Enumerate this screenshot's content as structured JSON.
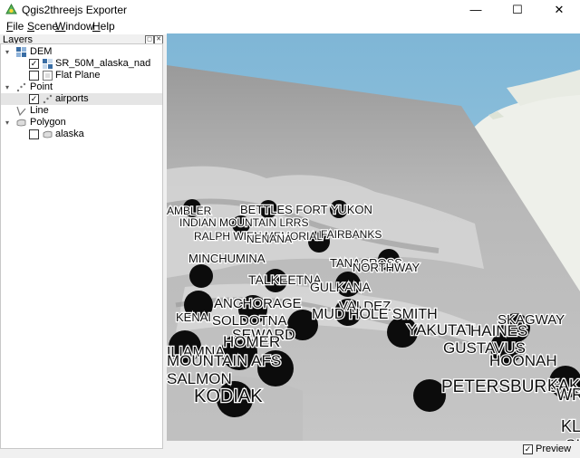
{
  "window": {
    "title": "Qgis2threejs Exporter",
    "controls": {
      "minimize": "—",
      "maximize": "☐",
      "close": "✕"
    }
  },
  "menu": [
    {
      "label": "File",
      "mnemonic": "F",
      "rest": "ile"
    },
    {
      "label": "Scene",
      "mnemonic": "S",
      "rest": "cene"
    },
    {
      "label": "Window",
      "mnemonic": "W",
      "rest": "indow"
    },
    {
      "label": "Help",
      "mnemonic": "H",
      "rest": "elp"
    }
  ],
  "layers_panel": {
    "title": "Layers",
    "groups": [
      {
        "label": "DEM",
        "expanded": true,
        "items": [
          {
            "label": "SR_50M_alaska_nad",
            "checked": true
          },
          {
            "label": "Flat Plane",
            "checked": false
          }
        ]
      },
      {
        "label": "Point",
        "expanded": true,
        "items": [
          {
            "label": "airports",
            "checked": true,
            "selected": true
          }
        ]
      },
      {
        "label": "Line",
        "expanded": false,
        "items": []
      },
      {
        "label": "Polygon",
        "expanded": true,
        "items": [
          {
            "label": "alaska",
            "checked": false
          }
        ]
      }
    ]
  },
  "map_labels": [
    {
      "text": "AMBLER",
      "size": 12
    },
    {
      "text": "BETTLES FORT YUKON",
      "size": 13
    },
    {
      "text": "INDIAN MOUNTAIN LRRS",
      "size": 12
    },
    {
      "text": "RALPH WIEN MEMORIAL",
      "size": 12
    },
    {
      "text": "NENANA",
      "size": 12
    },
    {
      "text": "FAIRBANKS",
      "size": 12
    },
    {
      "text": "MINCHUMINA",
      "size": 13
    },
    {
      "text": "TANACROSS",
      "size": 13
    },
    {
      "text": "NORTHWAY",
      "size": 13
    },
    {
      "text": "TALKEETNA",
      "size": 14
    },
    {
      "text": "GULKANA",
      "size": 14
    },
    {
      "text": "ANCHORAGE",
      "size": 15
    },
    {
      "text": "VALDEZ",
      "size": 15
    },
    {
      "text": "KENAI",
      "size": 13
    },
    {
      "text": "SOLDOTNA",
      "size": 15
    },
    {
      "text": "SEWARD",
      "size": 16
    },
    {
      "text": "MUD HOLE SMITH",
      "size": 16
    },
    {
      "text": "YAKUTAT",
      "size": 17
    },
    {
      "text": "HAINES",
      "size": 17
    },
    {
      "text": "SKAGWAY",
      "size": 15
    },
    {
      "text": "GUSTAVUS",
      "size": 17
    },
    {
      "text": "HOONAH",
      "size": 17
    },
    {
      "text": "HOMER",
      "size": 17
    },
    {
      "text": "ILIAMNA",
      "size": 16
    },
    {
      "text": "MOUNTAIN AFS",
      "size": 17
    },
    {
      "text": "SALMON",
      "size": 17
    },
    {
      "text": "KODIAK",
      "size": 20
    },
    {
      "text": "PETERSBURG",
      "size": 19
    },
    {
      "text": "KAKE",
      "size": 18
    },
    {
      "text": "WRANGELL",
      "size": 18
    },
    {
      "text": "KLAWOCK",
      "size": 18
    },
    {
      "text": "SITKA",
      "size": 17
    }
  ],
  "statusbar": {
    "preview_label": "Preview",
    "preview_checked": true
  }
}
